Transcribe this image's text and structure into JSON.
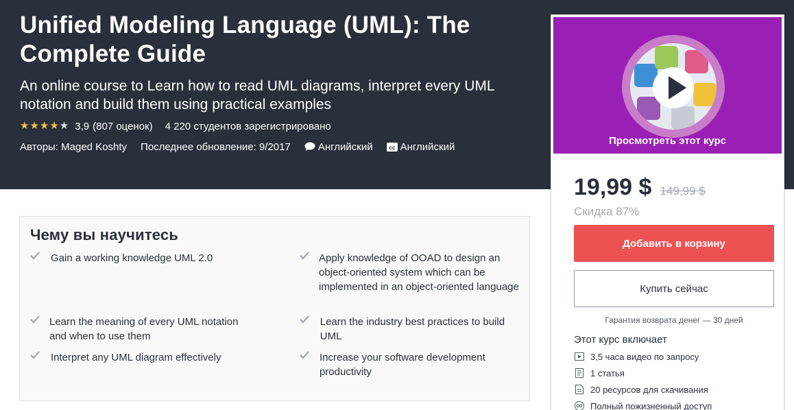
{
  "course": {
    "title": "Unified Modeling Language (UML): The Complete Guide",
    "subtitle": "An online course to Learn how to read UML diagrams, interpret every UML notation and build them using practical examples",
    "rating": "3,9",
    "rating_count": "(807 оценок)",
    "rating_stars": 3.9,
    "students": "4 220 студентов зарегистрировано",
    "authors": "Авторы: Maged Koshty",
    "last_update": "Последнее обновление: 9/2017",
    "language": "Английский",
    "captions": "Английский"
  },
  "preview": {
    "label": "Просмотреть этот курс"
  },
  "pricing": {
    "price": "19,99 $",
    "old_price": "149,99 $",
    "discount": "Скидка 87%",
    "add_to_cart": "Добавить в корзину",
    "buy_now": "Купить сейчас",
    "guarantee": "Гарантия возврата денег — 30 дней"
  },
  "includes": {
    "title": "Этот курс включает",
    "items": [
      {
        "icon": "video-icon",
        "label": "3,5 часа видео по запросу"
      },
      {
        "icon": "article-icon",
        "label": "1 статья"
      },
      {
        "icon": "download-icon",
        "label": "20 ресурсов для скачивания"
      },
      {
        "icon": "infinity-icon",
        "label": "Полный пожизненный доступ"
      }
    ]
  },
  "learn": {
    "title": "Чему вы научитесь",
    "left": [
      "Gain a working knowledge UML 2.0",
      "Learn the meaning of every UML notation and when to use them",
      "Interpret any UML diagram effectively"
    ],
    "right": [
      "Apply knowledge of OOAD to design an object-oriented system which can be implemented in an object-oriented language",
      "Learn the industry best practices to build UML",
      "Increase your software development productivity"
    ]
  },
  "colors": {
    "hero_bg": "#29303b",
    "star": "#f4c150",
    "cart_button": "#ec5252",
    "preview_bg": "#9a1fb5"
  }
}
